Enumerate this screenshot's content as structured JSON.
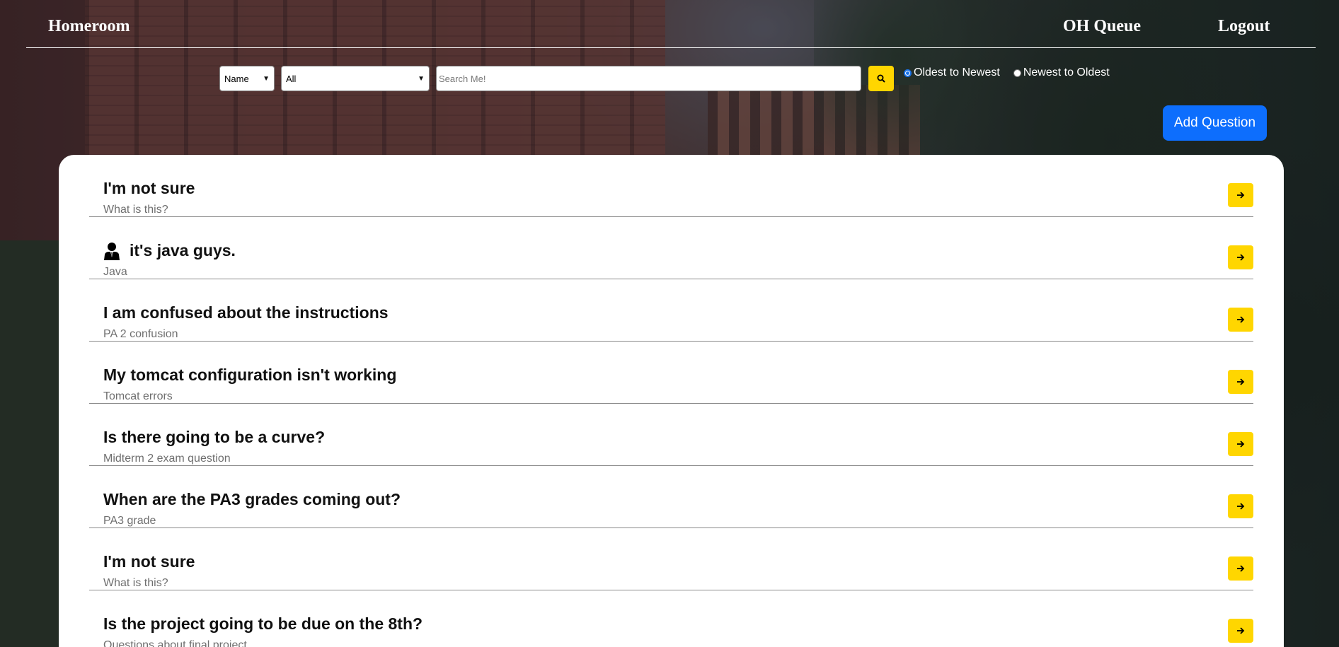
{
  "nav": {
    "brand": "Homeroom",
    "links": [
      "OH Queue",
      "Logout"
    ]
  },
  "search": {
    "field_select": "Name",
    "category_select": "All",
    "placeholder": "Search Me!",
    "sort_options": [
      "Oldest to Newest",
      "Newest to Oldest"
    ],
    "sort_selected": "Oldest to Newest"
  },
  "add_question_label": "Add Question",
  "questions": [
    {
      "title": "I'm not sure",
      "subtitle": "What is this?",
      "icon": null
    },
    {
      "title": "it's java guys.",
      "subtitle": "Java",
      "icon": "person-icon"
    },
    {
      "title": "I am confused about the instructions",
      "subtitle": "PA 2 confusion",
      "icon": null
    },
    {
      "title": "My tomcat configuration isn't working",
      "subtitle": "Tomcat errors",
      "icon": null
    },
    {
      "title": "Is there going to be a curve?",
      "subtitle": "Midterm 2 exam question",
      "icon": null
    },
    {
      "title": "When are the PA3 grades coming out?",
      "subtitle": "PA3 grade",
      "icon": null
    },
    {
      "title": "I'm not sure",
      "subtitle": "What is this?",
      "icon": null
    },
    {
      "title": "Is the project going to be due on the 8th?",
      "subtitle": "Questions about final project",
      "icon": null
    }
  ],
  "colors": {
    "accent_yellow": "#ffd600",
    "primary_blue": "#0d6efd"
  }
}
